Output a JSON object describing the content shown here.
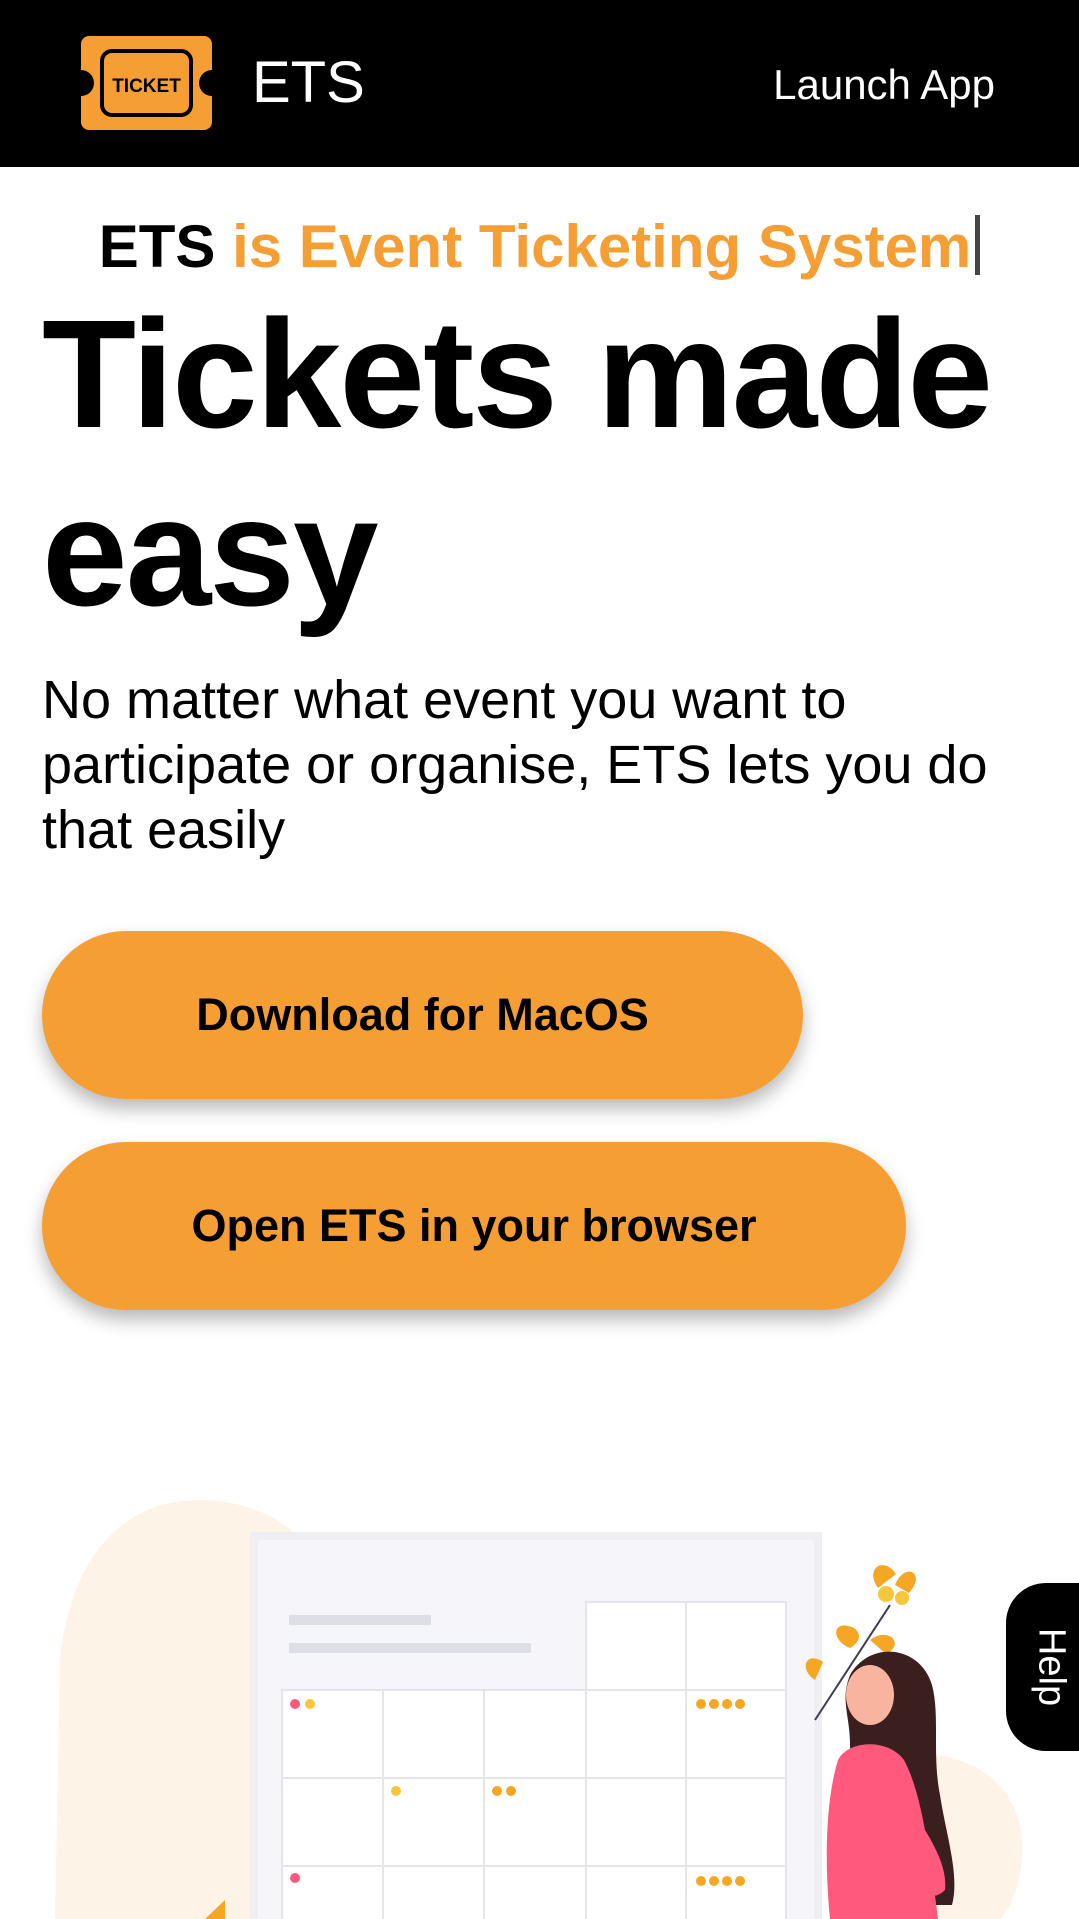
{
  "header": {
    "logo_text": "TICKET",
    "brand": "ETS",
    "launch_label": "Launch App"
  },
  "hero": {
    "tagline_prefix": "ETS",
    "tagline_highlight": "is Event Ticketing System",
    "headline": "Tickets made easy",
    "lede": "No matter what event you want to participate or organise, ETS lets you do that easily"
  },
  "buttons": {
    "download_mac": "Download for MacOS",
    "open_browser": "Open ETS in your browser"
  },
  "help": {
    "label": "Help"
  },
  "colors": {
    "accent": "#f59e33",
    "header_bg": "#000000",
    "dot_pink": "#ff5a7d",
    "dot_yellow": "#f7c63a",
    "dot_orange": "#f5a623"
  },
  "icons": {
    "logo": "ticket-icon"
  }
}
